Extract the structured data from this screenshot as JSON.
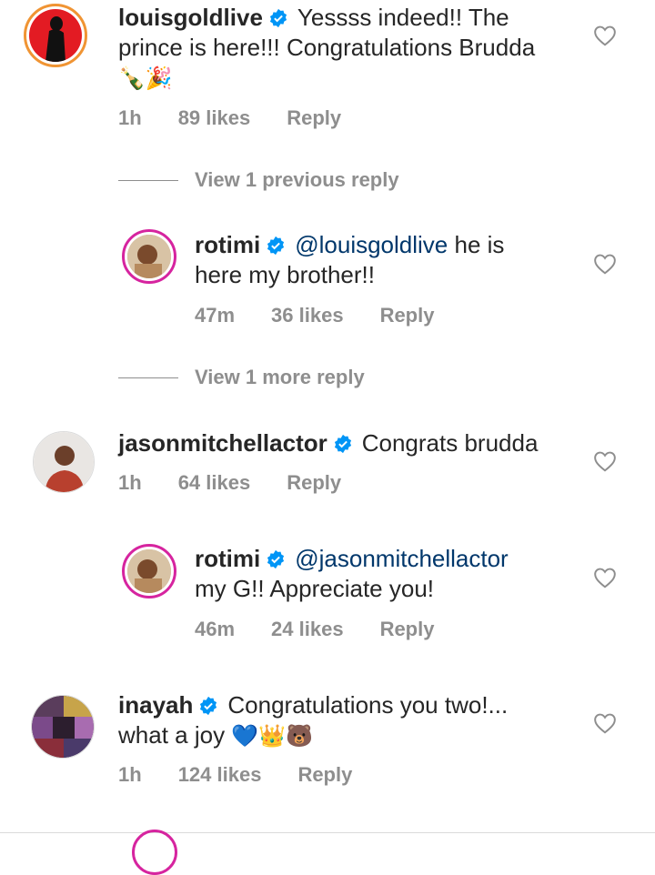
{
  "colors": {
    "verified": "#0095f6",
    "meta": "#8e8e8e",
    "mention": "#00376b",
    "story_ring": "#d6249f"
  },
  "icons": {
    "verified": "verified-badge-icon",
    "like": "heart-outline-icon"
  },
  "comments": [
    {
      "username": "louisgoldlive",
      "text_line1": "Yessss indeed!! The",
      "text_line2": "prince is here!!! Congratulations Brudda",
      "emojis": "🍾🎉",
      "time": "1h",
      "likes": "89 likes",
      "reply": "Reply"
    },
    {
      "view_replies": "View 1 previous reply"
    },
    {
      "username": "rotimi",
      "mention": "@louisgoldlive",
      "text_line1": " he is",
      "text_line2": "here my brother!!",
      "time": "47m",
      "likes": "36 likes",
      "reply": "Reply"
    },
    {
      "view_replies": "View 1 more reply"
    },
    {
      "username": "jasonmitchellactor",
      "text_line1": "Congrats brudda",
      "time": "1h",
      "likes": "64 likes",
      "reply": "Reply"
    },
    {
      "username": "rotimi",
      "mention": "@jasonmitchellactor",
      "text_line2": "my G!! Appreciate you!",
      "time": "46m",
      "likes": "24 likes",
      "reply": "Reply"
    },
    {
      "username": "inayah",
      "text_line1": "Congratulations you two!...",
      "text_line2": "what a joy",
      "emojis": "💙👑🐻",
      "time": "1h",
      "likes": "124 likes",
      "reply": "Reply"
    }
  ]
}
